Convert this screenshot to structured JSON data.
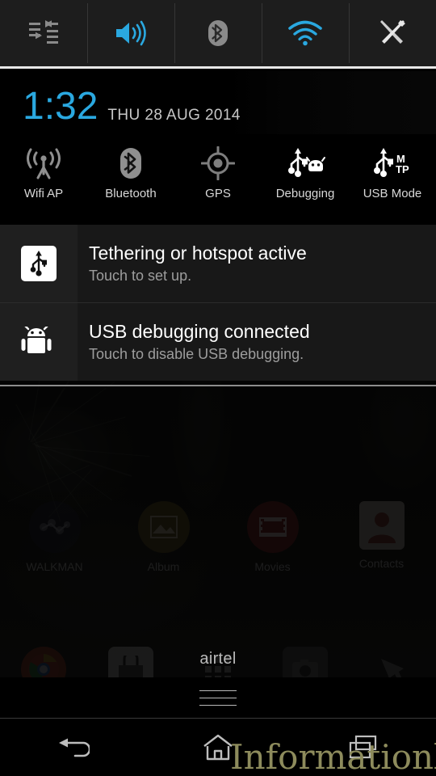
{
  "statusbar": {
    "items": [
      {
        "name": "data-transfer-icon",
        "label": "Data transfer",
        "state": "inactive",
        "color": "#8a8a8a"
      },
      {
        "name": "volume-icon",
        "label": "Volume",
        "state": "active",
        "color": "#2aa8e0"
      },
      {
        "name": "bluetooth-icon",
        "label": "Bluetooth",
        "state": "inactive",
        "color": "#8a8a8a"
      },
      {
        "name": "wifi-icon",
        "label": "Wi-Fi",
        "state": "active",
        "color": "#2aa8e0"
      },
      {
        "name": "settings-tools-icon",
        "label": "Settings",
        "state": "inactive",
        "color": "#d0d0d0"
      }
    ]
  },
  "clock": {
    "time": "1:32",
    "date": "THU 28 AUG 2014",
    "time_color": "#2aa8e0",
    "date_color": "#c7c7c7"
  },
  "quick_settings": {
    "toggles": [
      {
        "icon": "wifi-ap-icon",
        "label": "Wifi AP",
        "state": "off"
      },
      {
        "icon": "bluetooth-icon",
        "label": "Bluetooth",
        "state": "off"
      },
      {
        "icon": "gps-icon",
        "label": "GPS",
        "state": "off"
      },
      {
        "icon": "usb-debugging-icon",
        "label": "Debugging",
        "state": "on"
      },
      {
        "icon": "usb-mtp-icon",
        "label": "USB Mode",
        "state": "on",
        "badge": "MTP"
      }
    ]
  },
  "notifications": [
    {
      "icon": "usb-tethering-icon",
      "title": "Tethering or hotspot active",
      "subtitle": "Touch to set up."
    },
    {
      "icon": "android-bugdroid-icon",
      "title": "USB debugging connected",
      "subtitle": "Touch to disable USB debugging."
    }
  ],
  "home_screen": {
    "apps": [
      {
        "label": "WALKMAN",
        "icon": "walkman-icon",
        "color": "#1a1a22"
      },
      {
        "label": "Album",
        "icon": "album-icon",
        "color": "#6b5a1e"
      },
      {
        "label": "Movies",
        "icon": "movies-icon",
        "color": "#8a2020"
      },
      {
        "label": "Contacts",
        "icon": "contacts-icon",
        "color": "#8a3a32"
      }
    ],
    "dock": [
      {
        "label": "Chrome",
        "icon": "chrome-icon",
        "color": "#a83a2a"
      },
      {
        "label": "Play Store",
        "icon": "play-store-icon",
        "color": "#3a3a3a"
      },
      {
        "label": "App Drawer",
        "icon": "app-drawer-icon",
        "color": "#2a2a2a"
      },
      {
        "label": "Camera",
        "icon": "camera-icon",
        "color": "#3a3a3a"
      },
      {
        "label": "Messaging",
        "icon": "messaging-icon",
        "color": "#3a3a3a"
      }
    ]
  },
  "carrier": {
    "name": "airtel"
  },
  "drag_handle": {
    "name": "notification-shade-drag-handle"
  },
  "navbar": {
    "buttons": [
      {
        "icon": "back-icon",
        "label": "Back"
      },
      {
        "icon": "home-icon",
        "label": "Home"
      },
      {
        "icon": "recents-icon",
        "label": "Recent apps"
      }
    ]
  },
  "watermark": {
    "text": "Informationlord",
    "color": "#8d8b5c"
  }
}
